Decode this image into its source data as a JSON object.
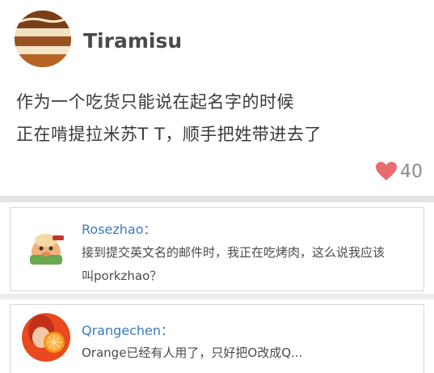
{
  "post": {
    "username": "Tiramisu",
    "avatar_icon": "tiramisu-avatar",
    "text_lines": [
      "作为一个吃货只能说在起名字的时候",
      "正在啃提拉米苏T T，顺手把姓带进去了"
    ],
    "likes": "40",
    "like_color": "#e86c6c"
  },
  "comments": [
    {
      "username": "Rosezhao：",
      "avatar_icon": "cartoon-pig-avatar",
      "text_lines": [
        "接到提交英文名的邮件时，我正在吃烤肉，这么说我应该",
        "叫porkzhao？"
      ]
    },
    {
      "username": "Qrangechen：",
      "avatar_icon": "orange-avatar",
      "text_lines": [
        "Orange已经有人用了，只好把O改成Q..."
      ]
    }
  ],
  "colors": {
    "name_link": "#3b7bbf",
    "separator": "#e3e3e3",
    "card_border": "#d8d8d8"
  }
}
